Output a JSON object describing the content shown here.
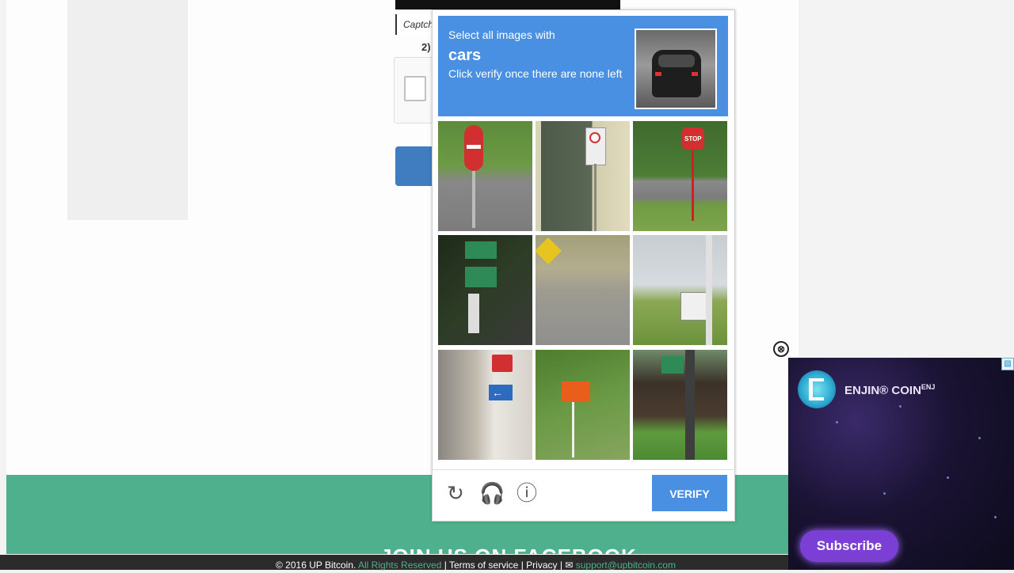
{
  "background": {
    "captcha_label": "Captch",
    "step_label": "2)"
  },
  "captcha": {
    "instruction_line1": "Select all images with",
    "target": "cars",
    "instruction_line3": "Click verify once there are none left",
    "tiles": [
      "no-entry-sign-road",
      "no-parking-sign-garage",
      "stop-sign-road",
      "green-street-signs",
      "curve-warning-sign",
      "roadside-notice-board",
      "one-way-sign-building",
      "orange-sign-hillside",
      "street-sign-building"
    ],
    "tools": {
      "reload": "reload-icon",
      "audio": "headphones-icon",
      "info": "info-icon"
    },
    "verify_label": "VERIFY"
  },
  "footer": {
    "title": "JOIN US ON FACEBOOK",
    "copyright": "© 2016 UP Bitcoin.",
    "rights": "All Rights Reserved",
    "sep1": "|",
    "terms": "Terms of service",
    "sep2": "|",
    "privacy": "Privacy",
    "sep3": "|",
    "email": "support@upbitcoin.com"
  },
  "ad": {
    "brand": "ENJIN® COIN",
    "ticker": "ENJ",
    "subscribe": "Subscribe",
    "close": "⊗",
    "corner": "▨"
  },
  "colors": {
    "header_blue": "#4a90e2",
    "footer_green": "#4eb08c",
    "subscribe_purple": "#7b3fd6"
  }
}
